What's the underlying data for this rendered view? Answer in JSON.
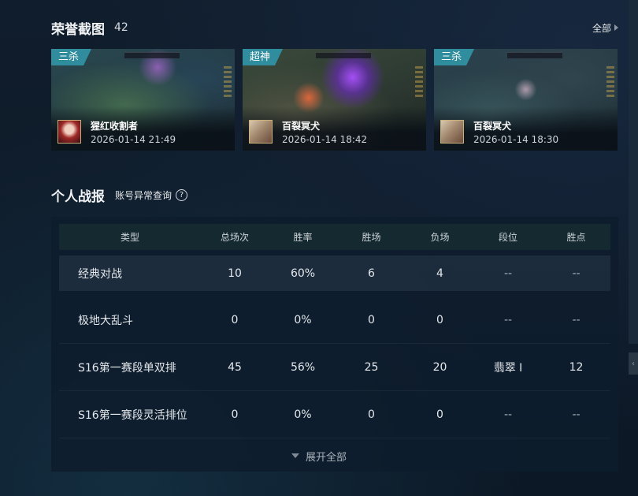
{
  "honor": {
    "title": "荣誉截图",
    "count": "42",
    "view_all": "全部",
    "items": [
      {
        "badge": "三杀",
        "champion": "猩红收割者",
        "time": "2026-01-14 21:49"
      },
      {
        "badge": "超神",
        "champion": "百裂冥犬",
        "time": "2026-01-14 18:42"
      },
      {
        "badge": "三杀",
        "champion": "百裂冥犬",
        "time": "2026-01-14 18:30"
      }
    ]
  },
  "stats": {
    "title": "个人战报",
    "anomaly_link": "账号异常查询",
    "help": "?",
    "columns": [
      "类型",
      "总场次",
      "胜率",
      "胜场",
      "负场",
      "段位",
      "胜点"
    ],
    "rows": [
      [
        "经典对战",
        "10",
        "60%",
        "6",
        "4",
        "--",
        "--"
      ],
      [
        "极地大乱斗",
        "0",
        "0%",
        "0",
        "0",
        "--",
        "--"
      ],
      [
        "S16第一赛段单双排",
        "45",
        "56%",
        "25",
        "20",
        "翡翠 Ⅰ",
        "12"
      ],
      [
        "S16第一赛段灵活排位",
        "0",
        "0%",
        "0",
        "0",
        "--",
        "--"
      ]
    ],
    "expand_label": "展开全部"
  },
  "colors": {
    "badge": "#2f8d9e",
    "background": "#0e1a28",
    "panel": "#0e1c2c"
  },
  "icons": {
    "view_all": "triangle-right-icon",
    "expand": "triangle-down-icon",
    "help": "question-circle-icon"
  }
}
